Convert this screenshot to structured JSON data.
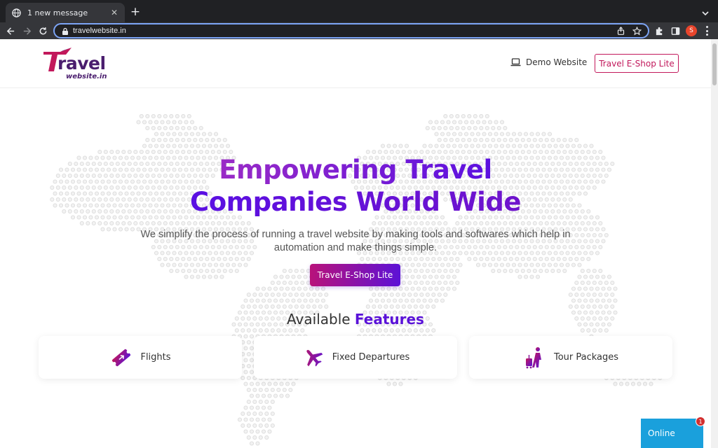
{
  "browser": {
    "tab": {
      "title": "1 new message",
      "close": "✕"
    },
    "new_tab": "+",
    "address": "travelwebsite.in",
    "profile_initial": "S"
  },
  "header": {
    "logo_word": "ravel",
    "logo_sub": "website.in",
    "demo_label": "Demo Website",
    "eshop_label": "Travel E-Shop Lite"
  },
  "hero": {
    "title_line1": "Empowering Travel",
    "title_line2": "Companies World Wide",
    "subtitle": "We simplify the process of running a travel website by making tools and softwares which help in automation and make things simple.",
    "cta_label": "Travel E-Shop Lite"
  },
  "features": {
    "title_plain": "Available ",
    "title_accent": "Features",
    "items": [
      {
        "label": "Flights",
        "icon": "ticket-plane-icon"
      },
      {
        "label": "Fixed Departures",
        "icon": "airplane-icon"
      },
      {
        "label": "Tour Packages",
        "icon": "traveler-luggage-icon"
      }
    ]
  },
  "chat": {
    "status": "Online",
    "badge_count": "1"
  },
  "colors": {
    "brand_pink": "#c2185b",
    "brand_purple": "#5a12d8",
    "chat_blue": "#1aa0dc"
  }
}
